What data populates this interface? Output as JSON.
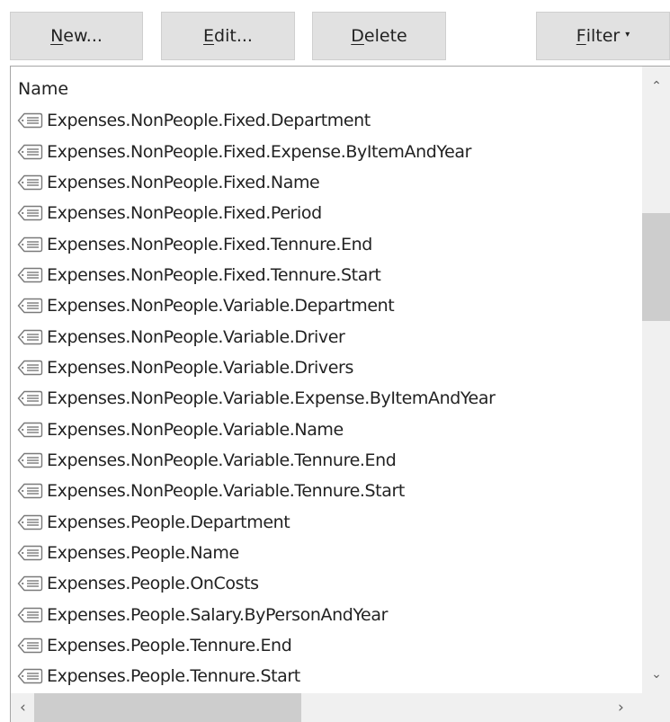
{
  "toolbar": {
    "new": {
      "mnemonic": "N",
      "rest": "ew..."
    },
    "edit": {
      "mnemonic": "E",
      "rest": "dit..."
    },
    "delete": {
      "mnemonic": "D",
      "rest": "elete"
    },
    "filter": {
      "mnemonic": "F",
      "rest": "ilter",
      "caret": "▾"
    }
  },
  "list": {
    "header": "Name",
    "items": [
      "Expenses.NonPeople.Fixed.Department",
      "Expenses.NonPeople.Fixed.Expense.ByItemAndYear",
      "Expenses.NonPeople.Fixed.Name",
      "Expenses.NonPeople.Fixed.Period",
      "Expenses.NonPeople.Fixed.Tennure.End",
      "Expenses.NonPeople.Fixed.Tennure.Start",
      "Expenses.NonPeople.Variable.Department",
      "Expenses.NonPeople.Variable.Driver",
      "Expenses.NonPeople.Variable.Drivers",
      "Expenses.NonPeople.Variable.Expense.ByItemAndYear",
      "Expenses.NonPeople.Variable.Name",
      "Expenses.NonPeople.Variable.Tennure.End",
      "Expenses.NonPeople.Variable.Tennure.Start",
      "Expenses.People.Department",
      "Expenses.People.Name",
      "Expenses.People.OnCosts",
      "Expenses.People.Salary.ByPersonAndYear",
      "Expenses.People.Tennure.End",
      "Expenses.People.Tennure.Start"
    ],
    "item_icon": "named-range-icon"
  },
  "scrollbars": {
    "up_arrow": "⌃",
    "down_arrow": "⌄",
    "left_arrow": "‹",
    "right_arrow": "›"
  }
}
